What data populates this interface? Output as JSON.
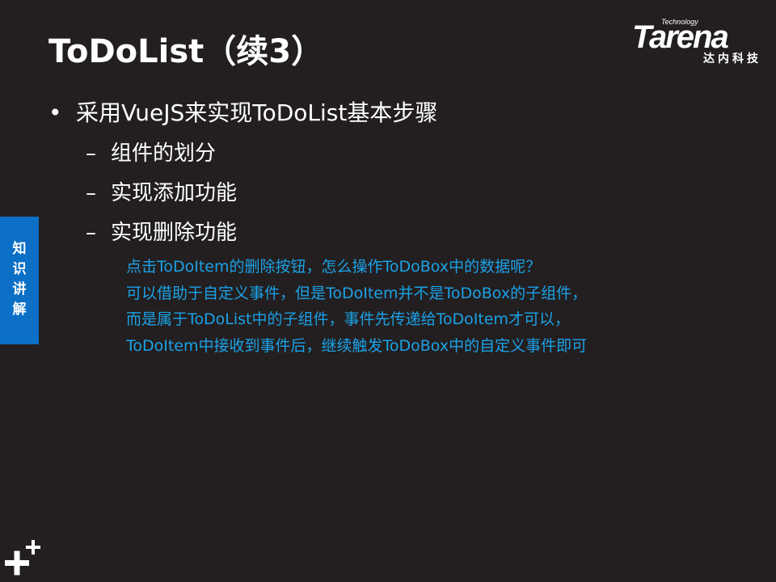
{
  "slide": {
    "title": "ToDoList（续3）",
    "bullet": "采用VueJS来实现ToDoList基本步骤",
    "sub_items": [
      "组件的划分",
      "实现添加功能",
      "实现删除功能"
    ],
    "note_lines": [
      "点击ToDoItem的删除按钮，怎么操作ToDoBox中的数据呢？",
      "可以借助于自定义事件，但是ToDoItem并不是ToDoBox的子组件，",
      "而是属于ToDoList中的子组件，事件先传递给ToDoItem才可以，",
      "ToDoItem中接收到事件后，继续触发ToDoBox中的自定义事件即可"
    ]
  },
  "logo": {
    "small_text": "Technology",
    "word": "Tarena",
    "chinese": "达内科技"
  },
  "side_tab": {
    "chars": [
      "知",
      "识",
      "讲",
      "解"
    ]
  },
  "symbols": {
    "bullet": "•",
    "dash": "–"
  },
  "colors": {
    "background": "#231f20",
    "text": "#ffffff",
    "note": "#1ba1e6",
    "side_tab": "#0b6fc6"
  },
  "icons": {
    "corner": "plus-plus-icon"
  }
}
